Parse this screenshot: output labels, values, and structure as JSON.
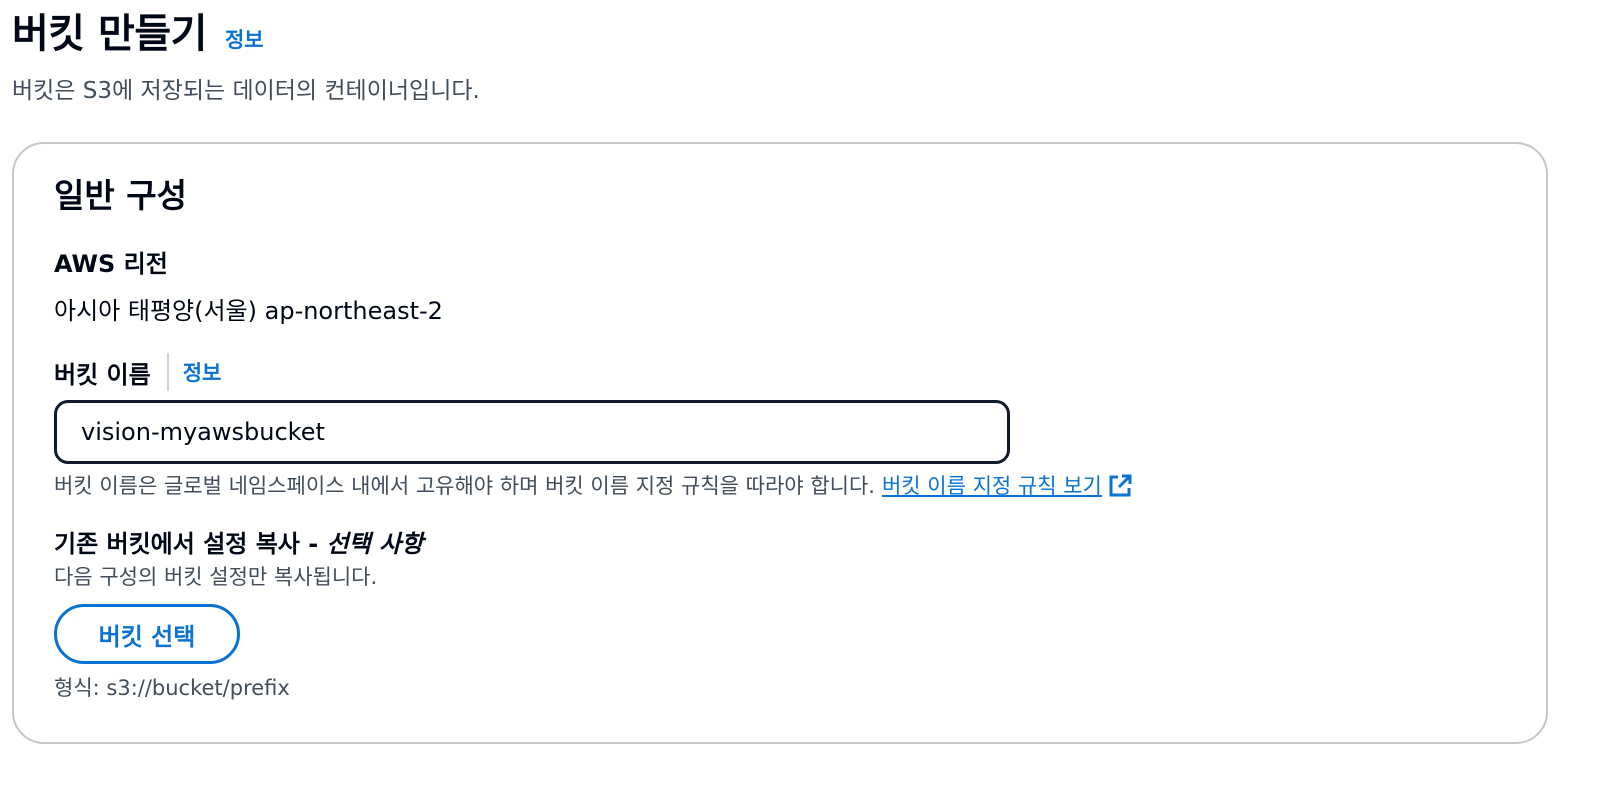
{
  "page": {
    "title": "버킷 만들기",
    "info_link": "정보",
    "description": "버킷은 S3에 저장되는 데이터의 컨테이너입니다."
  },
  "general": {
    "title": "일반 구성",
    "region_label": "AWS 리전",
    "region_value": "아시아 태평양(서울) ap-northeast-2",
    "bucket_name_label": "버킷 이름",
    "bucket_name_info": "정보",
    "bucket_name_value": "vision-myawsbucket",
    "bucket_name_constraint": "버킷 이름은 글로벌 네임스페이스 내에서 고유해야 하며 버킷 이름 지정 규칙을 따라야 합니다.",
    "naming_rules_link": "버킷 이름 지정 규칙 보기",
    "copy_label": "기존 버킷에서 설정 복사 -",
    "copy_optional": "선택 사항",
    "copy_description": "다음 구성의 버킷 설정만 복사됩니다.",
    "choose_bucket_button": "버킷 선택",
    "format_hint": "형식: s3://bucket/prefix"
  },
  "icons": {
    "external_link": "external-link-icon"
  },
  "colors": {
    "link": "#0972d3",
    "text": "#000716",
    "secondary_text": "#414d5c",
    "border": "#c6c6cd",
    "input_focus_border": "#0f1b2d"
  }
}
